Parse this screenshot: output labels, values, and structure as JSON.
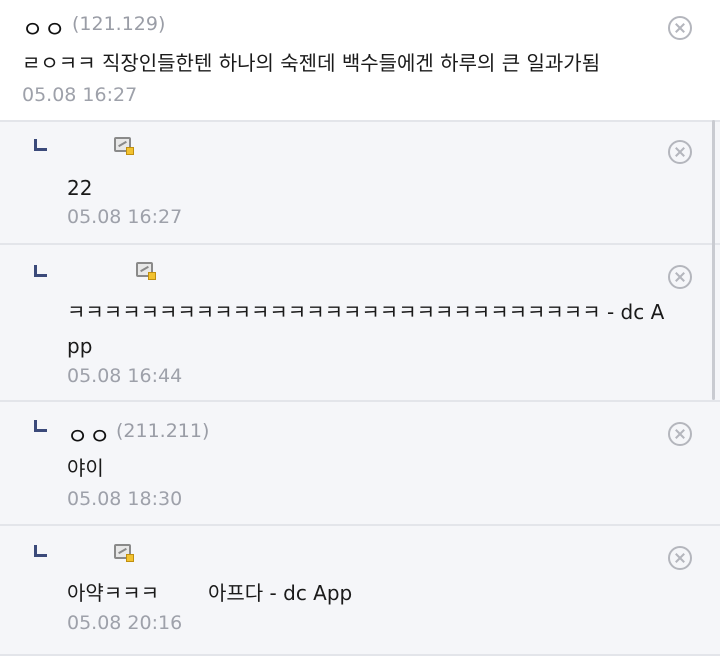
{
  "comments": [
    {
      "nick": "ㅇㅇ",
      "ip": "(121.129)",
      "text": "ㄹㅇㅋㅋ 직장인들한텐 하나의 숙젠데 백수들에겐 하루의 큰 일과가됨",
      "time": "05.08 16:27"
    },
    {
      "text": "22",
      "time": "05.08 16:27"
    },
    {
      "text_line1": "ㅋㅋㅋㅋㅋㅋㅋㅋㅋㅋㅋㅋㅋㅋㅋㅋㅋㅋㅋㅋㅋㅋㅋㅋㅋㅋㅋㅋㅋ - dc A",
      "text_line2": "pp",
      "time": "05.08 16:44"
    },
    {
      "nick": "ㅇㅇ",
      "ip": "(211.211)",
      "text": "야이",
      "time": "05.08 18:30"
    },
    {
      "text_part1": "아약ㅋㅋㅋ",
      "text_part2": "아프다 - dc App",
      "time": "05.08 20:16"
    }
  ],
  "icons": {
    "delete": "delete-circle-x-icon",
    "reply": "reply-arrow-icon",
    "gallog": "gallog-icon"
  }
}
